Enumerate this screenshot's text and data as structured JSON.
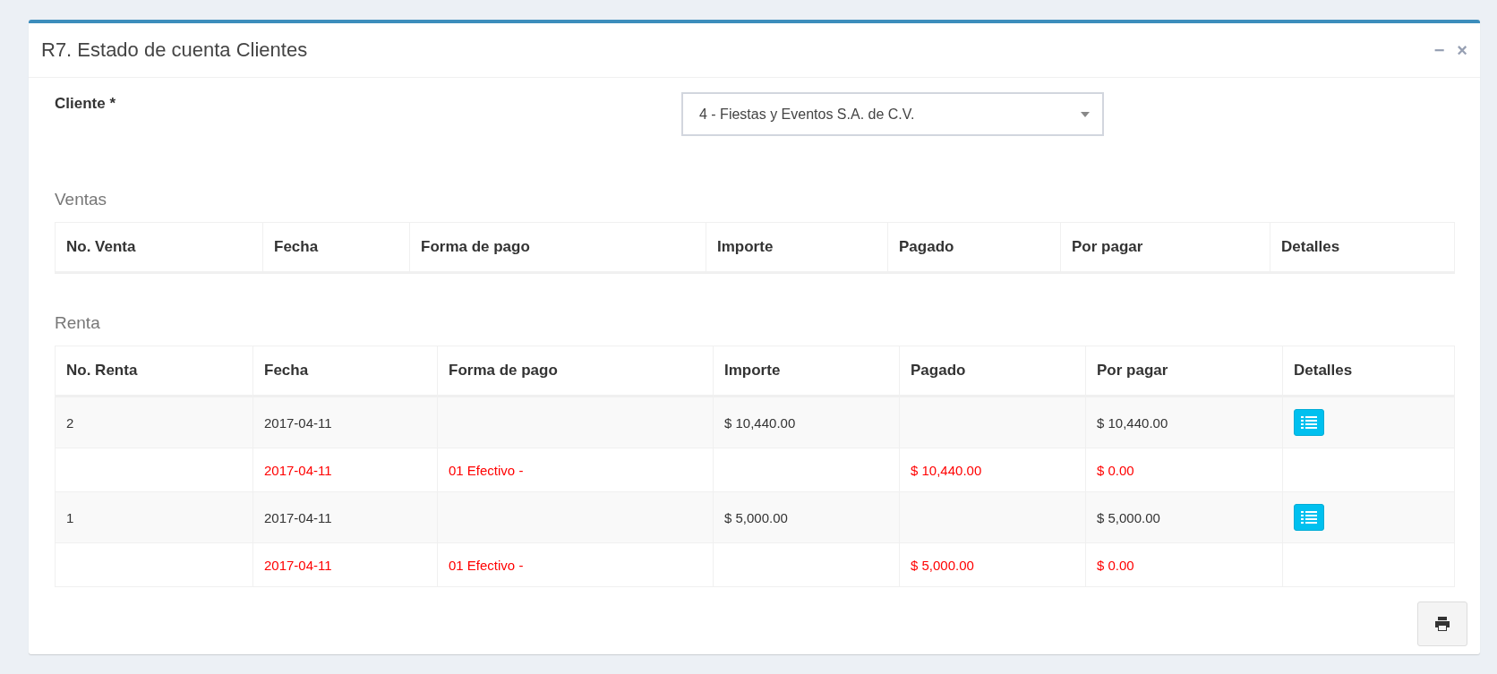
{
  "panel": {
    "title": "R7. Estado de cuenta Clientes",
    "controls": [
      "−",
      "×"
    ]
  },
  "filter": {
    "label": "Cliente *",
    "value": "4 - Fiestas y Eventos S.A. de C.V."
  },
  "sections": [
    {
      "title": "Ventas",
      "columns": [
        "No. Venta",
        "Fecha",
        "Forma de pago",
        "Importe",
        "Pagado",
        "Por pagar",
        "Detalles"
      ]
    },
    {
      "title": "Renta",
      "columns": [
        "No. Renta",
        "Fecha",
        "Forma de pago",
        "Importe",
        "Pagado",
        "Por pagar",
        "Detalles"
      ],
      "rows": [
        {
          "kind": "rent",
          "cells": [
            "2",
            "2017-04-11",
            "",
            "$ 10,440.00",
            "",
            "$ 10,440.00"
          ]
        },
        {
          "kind": "payment",
          "cells": [
            "",
            "2017-04-11",
            "01 Efectivo -",
            "",
            "$ 10,440.00",
            "$ 0.00"
          ]
        },
        {
          "kind": "rent",
          "cells": [
            "1",
            "2017-04-11",
            "",
            "$ 5,000.00",
            "",
            "$ 5,000.00"
          ]
        },
        {
          "kind": "payment",
          "cells": [
            "",
            "2017-04-11",
            "01 Efectivo -",
            "",
            "$ 5,000.00",
            "$ 0.00"
          ]
        }
      ]
    }
  ]
}
